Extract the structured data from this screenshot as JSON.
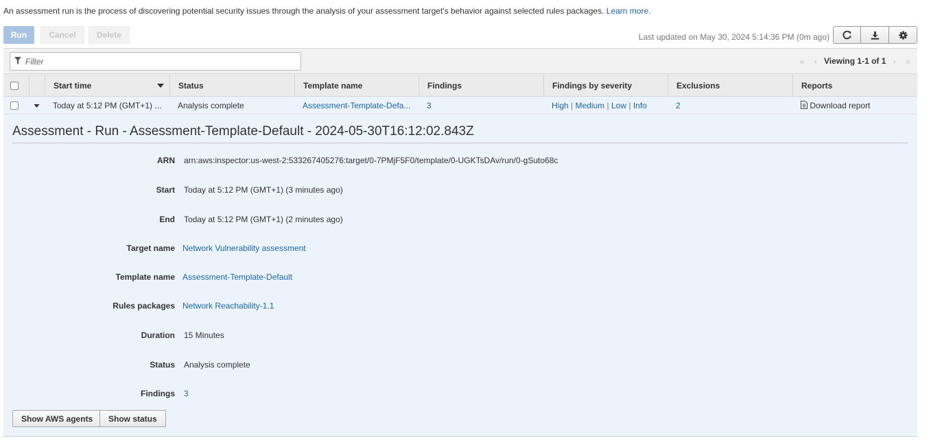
{
  "intro": {
    "text": "An assessment run is the process of discovering potential security issues through the analysis of your assessment target's behavior against selected rules packages.",
    "link": "Learn more."
  },
  "toolbar": {
    "run_label": "Run",
    "cancel_label": "Cancel",
    "delete_label": "Delete",
    "last_updated": "Last updated on May 30, 2024 5:14:36 PM (0m ago)",
    "icons": [
      "refresh-icon",
      "download-icon",
      "settings-icon"
    ]
  },
  "filter": {
    "placeholder": "Filter"
  },
  "pagination": {
    "text": "Viewing 1-1 of 1",
    "first": "«",
    "prev": "‹",
    "next": "›",
    "last": "»"
  },
  "table": {
    "columns": [
      "Start time",
      "Status",
      "Template name",
      "Findings",
      "Findings by severity",
      "Exclusions",
      "Reports"
    ],
    "row": {
      "start_time": "Today at 5:12 PM (GMT+1) ...",
      "status": "Analysis complete",
      "template_name": "Assessment-Template-Defa...",
      "findings": "3",
      "severity": [
        "High",
        "Medium",
        "Low",
        "Info"
      ],
      "severity_sep": "|",
      "exclusions": "2",
      "report": "Download report"
    }
  },
  "detail": {
    "title": "Assessment - Run - Assessment-Template-Default - 2024-05-30T16:12:02.843Z",
    "fields": [
      {
        "label": "ARN",
        "value": "arn:aws:inspector:us-west-2:533267405276:target/0-7PMjF5F0/template/0-UGKTsDAv/run/0-gSuto68c"
      },
      {
        "label": "Start",
        "value": "Today at 5:12 PM (GMT+1) (3 minutes ago)"
      },
      {
        "label": "End",
        "value": "Today at 5:12 PM (GMT+1) (2 minutes ago)"
      },
      {
        "label": "Target name",
        "value": "Network Vulnerability assessment"
      },
      {
        "label": "Template name",
        "value": "Assessment-Template-Default"
      },
      {
        "label": "Rules packages",
        "value": "Network Reachability-1.1"
      },
      {
        "label": "Duration",
        "value": "15 Minutes"
      },
      {
        "label": "Status",
        "value": "Analysis complete"
      },
      {
        "label": "Findings",
        "value": "3"
      }
    ],
    "show_agents_label": "Show AWS agents",
    "show_status_label": "Show status"
  },
  "colors": {
    "link": "#1a66a8",
    "row_highlight": "#ecf3fb",
    "primary_disabled": "#a9c4e3"
  }
}
